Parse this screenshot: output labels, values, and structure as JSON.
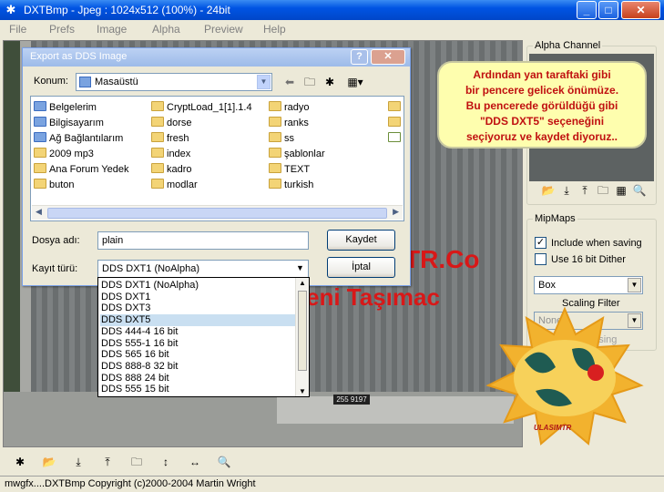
{
  "window": {
    "title": "DXTBmp - Jpeg : 1024x512 (100%) - 24bit"
  },
  "menu": [
    "File",
    "Prefs",
    "Image",
    "Alpha",
    "Preview",
    "Help"
  ],
  "dialog": {
    "title": "Export as DDS Image",
    "location_label": "Konum:",
    "location_value": "Masaüstü",
    "files": [
      [
        "Belgelerim",
        "sys"
      ],
      [
        "Bilgisayarım",
        "sys"
      ],
      [
        "Ağ Bağlantılarım",
        "sys"
      ],
      [
        "2009 mp3",
        "folder"
      ],
      [
        "Ana Forum Yedek",
        "folder"
      ],
      [
        "buton",
        "folder"
      ],
      [
        "CryptLoad_1[1].1.4",
        "folder"
      ],
      [
        "dorse",
        "folder"
      ],
      [
        "fresh",
        "folder"
      ],
      [
        "index",
        "folder"
      ],
      [
        "kadro",
        "folder"
      ],
      [
        "modlar",
        "folder"
      ],
      [
        "radyo",
        "folder"
      ],
      [
        "ranks",
        "folder"
      ],
      [
        "ss",
        "folder"
      ],
      [
        "şablonlar",
        "folder"
      ],
      [
        "TEXT",
        "folder"
      ],
      [
        "turkish",
        "folder"
      ]
    ],
    "filename_label": "Dosya adı:",
    "filename_value": "plain",
    "filetype_label": "Kayıt türü:",
    "filetype_value": "DDS DXT1 (NoAlpha)",
    "save_button": "Kaydet",
    "cancel_button": "İptal",
    "filetype_options": [
      "DDS DXT1 (NoAlpha)",
      "DDS DXT1",
      "DDS DXT3",
      "DDS DXT5",
      "DDS 444-4 16 bit",
      "DDS 555-1 16 bit",
      "DDS 565 16 bit",
      "DDS 888-8 32 bit",
      "DDS 888 24 bit",
      "DDS 555 15 bit"
    ],
    "selected_option_index": 3
  },
  "callout": {
    "lines": [
      "Ardından yan taraftaki gibi",
      "bir pencere gelicek önümüze.",
      "Bu pencerede görüldüğü gibi",
      "\"DDS DXT5\" seçeneğini",
      "seçiyoruz ve kaydet diyoruz.."
    ]
  },
  "right_panel": {
    "alpha_group": "Alpha Channel",
    "mipmaps_group": "MipMaps",
    "include_when_saving": "Include when saving",
    "include_checked": true,
    "use_16bit_dither": "Use 16 bit Dither",
    "dither_checked": false,
    "filter_value": "Box",
    "scaling_filter_label": "Scaling Filter",
    "scaling_value": "None",
    "processing": "Processing"
  },
  "canvas_overlay": {
    "text1": "TR.Co",
    "text2": "eni Taşımac",
    "plate": "255 9197",
    "logo": "ULASIMTR"
  },
  "status": "mwgfx....DXTBmp Copyright (c)2000-2004 Martin Wright",
  "colors": {
    "xp_blue": "#0054e3",
    "callout_bg": "#fefeae",
    "callout_text": "#c01010",
    "overlay_red": "#d81818"
  }
}
